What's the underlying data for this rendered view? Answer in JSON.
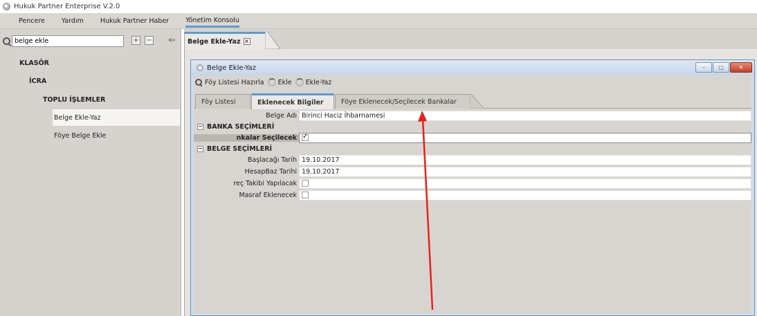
{
  "app": {
    "title": "Hukuk Partner Enterprise V.2.0"
  },
  "menu": [
    {
      "label": "Pencere"
    },
    {
      "label": "Yardım"
    },
    {
      "label": "Hukuk Partner Haber"
    },
    {
      "label": "Yönetim Konsolu"
    }
  ],
  "search": {
    "value": "belge ekle"
  },
  "tree_buttons": {
    "expand": "+",
    "collapse": "−",
    "back": "⇐"
  },
  "tree": [
    {
      "label": "KLASÖR",
      "bold": true
    },
    {
      "label": "İCRA",
      "bold": true
    },
    {
      "label": "TOPLU İŞLEMLER",
      "bold": true
    },
    {
      "label": "Belge Ekle-Yaz",
      "selected": true
    },
    {
      "label": "Föye Belge Ekle"
    }
  ],
  "doc_tab": {
    "label": "Belge Ekle-Yaz",
    "close": "×"
  },
  "inner_window": {
    "title": "Belge Ekle-Yaz",
    "buttons": {
      "minimize": "–",
      "maximize": "□",
      "close": "✕"
    }
  },
  "toolbar": {
    "prepare": "Föy Listesi Hazırla",
    "add": "Ekle",
    "add_write": "Ekle-Yaz"
  },
  "sub_tabs": [
    {
      "label": "Föy Listesi",
      "active": false
    },
    {
      "label": "Eklenecek Bilgiler",
      "active": true
    },
    {
      "label": "Föye Eklenecek/Seçilecek Bankalar",
      "active": false
    }
  ],
  "grid": {
    "belge_adi": {
      "label": "Belge Adı",
      "value": "Birinci Haciz İhbarnamesi"
    },
    "section_banka": {
      "label": "BANKA SEÇİMLERİ",
      "toggle": "−"
    },
    "bankalar": {
      "label": "nkalar Seçilecek",
      "checked": true
    },
    "section_belge": {
      "label": "BELGE SEÇİMLERİ",
      "toggle": "−"
    },
    "baslangic": {
      "label": "Başlacağı Tarih",
      "value": "19.10.2017"
    },
    "hesap": {
      "label": "HesapBaz Tarihi",
      "value": "19.10.2017"
    },
    "takip": {
      "label": "reç Takibi Yapılacak",
      "checked": false
    },
    "masraf": {
      "label": "Masraf Eklenecek",
      "checked": false
    }
  },
  "colors": {
    "accent": "#5b9ad5",
    "arrow": "#e8201a"
  }
}
